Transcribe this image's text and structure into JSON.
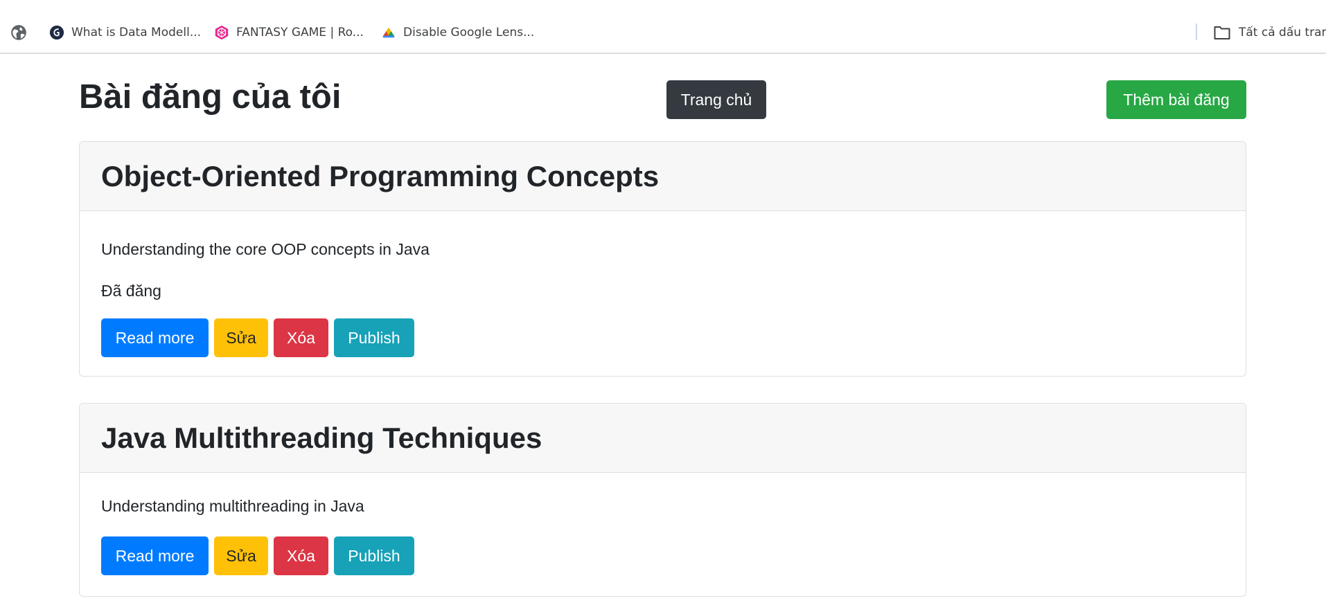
{
  "bookmarks": {
    "items": [
      {
        "label": "What is Data Modell...",
        "icon": "data-modeling-favicon-icon"
      },
      {
        "label": "FANTASY GAME | Ro...",
        "icon": "fantasy-game-favicon-icon"
      },
      {
        "label": "Disable Google Lens...",
        "icon": "chrome-favicon-icon"
      }
    ],
    "all_bookmarks_label": "Tất cả dấu trang"
  },
  "header": {
    "title": "Bài đăng của tôi",
    "home_button": "Trang chủ",
    "add_button": "Thêm bài đăng"
  },
  "posts": [
    {
      "title": "Object-Oriented Programming Concepts",
      "description": "Understanding the core OOP concepts in Java",
      "status": "Đã đăng",
      "actions": {
        "read_more": "Read more",
        "edit": "Sửa",
        "delete": "Xóa",
        "publish": "Publish"
      }
    },
    {
      "title": "Java Multithreading Techniques",
      "description": "Understanding multithreading in Java",
      "actions": {
        "read_more": "Read more",
        "edit": "Sửa",
        "delete": "Xóa",
        "publish": "Publish"
      }
    }
  ],
  "colors": {
    "home_button": "#343a40",
    "add_button": "#28a745",
    "read_more": "#007bff",
    "edit": "#ffc107",
    "delete": "#dc3545",
    "publish": "#17a2b8"
  }
}
